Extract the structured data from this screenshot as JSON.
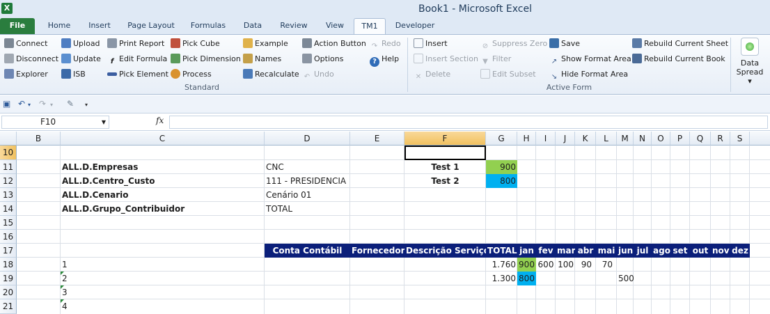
{
  "window": {
    "title": "Book1  -  Microsoft Excel",
    "app_icon": "X"
  },
  "tabs": [
    {
      "label": "File"
    },
    {
      "label": "Home"
    },
    {
      "label": "Insert"
    },
    {
      "label": "Page Layout"
    },
    {
      "label": "Formulas"
    },
    {
      "label": "Data"
    },
    {
      "label": "Review"
    },
    {
      "label": "View"
    },
    {
      "label": "TM1"
    },
    {
      "label": "Developer"
    }
  ],
  "ribbon": {
    "standard": {
      "label": "Standard",
      "col1": [
        "Connect",
        "Disconnect",
        "Explorer"
      ],
      "col2": [
        "Upload",
        "Update",
        "ISB"
      ],
      "col3": [
        "Print Report",
        "Edit Formula",
        "Pick Element"
      ],
      "col4": [
        "Pick Cube",
        "Pick Dimension",
        "Process"
      ],
      "col5": [
        "Example",
        "Names",
        "Recalculate"
      ],
      "col6": [
        "Action Button",
        "Options",
        "Undo"
      ],
      "col7": [
        "Redo",
        "Help"
      ]
    },
    "active_form": {
      "label": "Active Form",
      "col1": [
        "Insert",
        "Insert Section",
        "Delete"
      ],
      "col2": [
        "Suppress Zero",
        "Filter",
        "Edit Subset"
      ],
      "col3": [
        "Save",
        "Show Format Area",
        "Hide Format Area"
      ],
      "col4": [
        "Rebuild Current Sheet",
        "Rebuild Current Book"
      ]
    },
    "data_spread": {
      "line1": "Data",
      "line2": "Spread ▾"
    }
  },
  "formula_bar": {
    "name_box": "F10",
    "fx": "fx",
    "value": ""
  },
  "columns": [
    "B",
    "C",
    "D",
    "E",
    "F",
    "G",
    "H",
    "I",
    "J",
    "K",
    "L",
    "M",
    "N",
    "O",
    "P",
    "Q",
    "R",
    "S"
  ],
  "rows": [
    "10",
    "11",
    "12",
    "13",
    "14",
    "15",
    "16",
    "17",
    "18",
    "19",
    "20",
    "21"
  ],
  "cells": {
    "c11": "ALL.D.Empresas",
    "d11": "CNC",
    "c12": "ALL.D.Centro_Custo",
    "d12": "111 - PRESIDENCIA",
    "c13": "ALL.D.Cenario",
    "d13": "Cenário 01",
    "c14": "ALL.D.Grupo_Contribuidor",
    "d14": "TOTAL",
    "f11": "Test 1",
    "g11": "900",
    "f12": "Test 2",
    "g12": "800",
    "c18": "1",
    "c19": "2",
    "c20": "3",
    "c21": "4"
  },
  "table_header": [
    "Conta Contábil",
    "Fornecedor",
    "Descrição Serviço",
    "TOTAL",
    "jan",
    "fev",
    "mar",
    "abr",
    "mai",
    "jun",
    "jul",
    "ago",
    "set",
    "out",
    "nov",
    "dez"
  ],
  "table_rows": [
    {
      "total": "1.760",
      "jan": "900",
      "fev": "600",
      "mar": "100",
      "abr": "90",
      "mai": "70",
      "jun": ""
    },
    {
      "total": "1.300",
      "jan": "800",
      "fev": "",
      "mar": "",
      "abr": "",
      "mai": "",
      "jun": "500"
    }
  ],
  "colors": {
    "header_band": "#0b1f7a",
    "green": "#92d050",
    "blue": "#00b0f0"
  }
}
